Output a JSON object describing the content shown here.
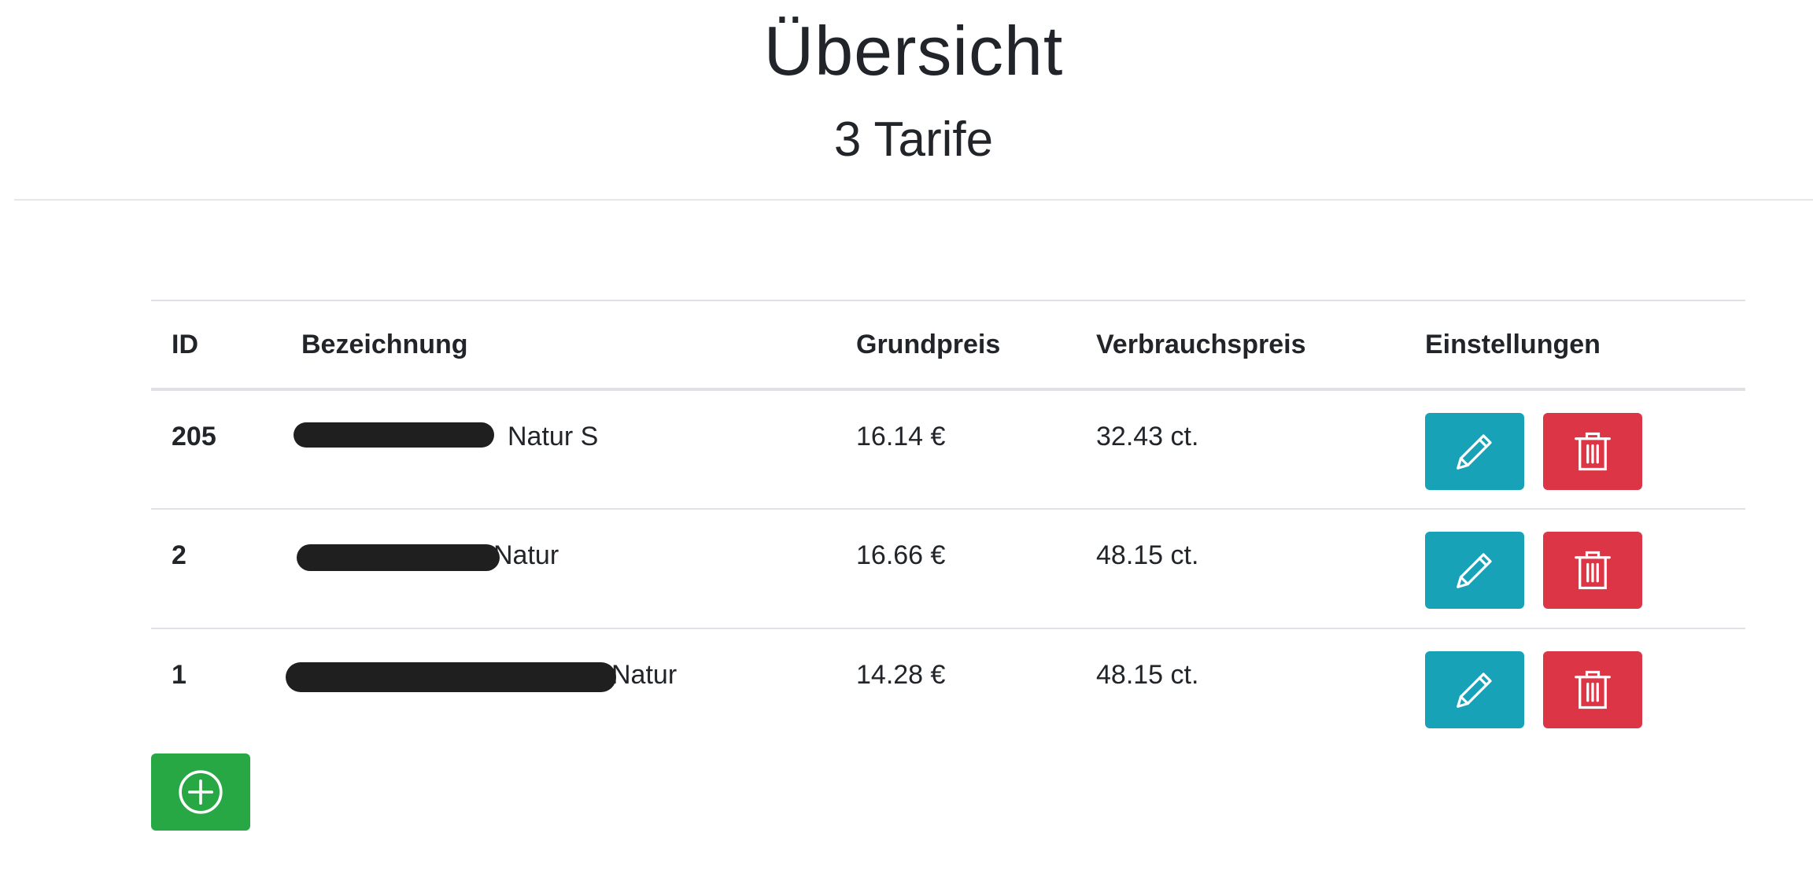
{
  "header": {
    "title": "Übersicht",
    "subtitle": "3 Tarife"
  },
  "table": {
    "columns": [
      "ID",
      "Bezeichnung",
      "Grundpreis",
      "Verbrauchspreis",
      "Einstellungen"
    ],
    "rows": [
      {
        "id": "205",
        "name_visible": "Natur S",
        "grundpreis": "16.14 €",
        "verbrauchspreis": "32.43 ct."
      },
      {
        "id": "2",
        "name_visible": "Natur",
        "grundpreis": "16.66 €",
        "verbrauchspreis": "48.15 ct."
      },
      {
        "id": "1",
        "name_visible": "Natur",
        "grundpreis": "14.28 €",
        "verbrauchspreis": "48.15 ct."
      }
    ]
  },
  "actions": {
    "edit_icon": "pencil-icon",
    "delete_icon": "trash-icon",
    "add_icon": "plus-circle-icon"
  },
  "colors": {
    "edit": "#17a2b8",
    "delete": "#dc3545",
    "add": "#28a745",
    "text": "#212529"
  }
}
